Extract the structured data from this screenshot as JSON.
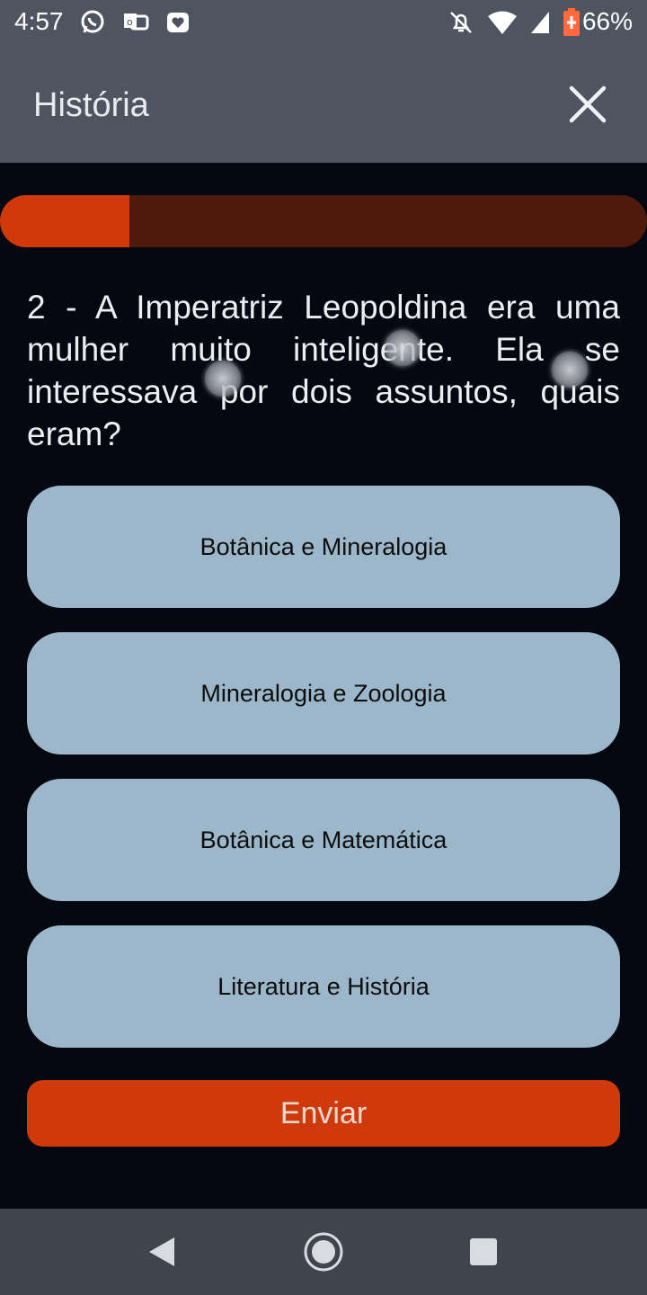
{
  "status_bar": {
    "time": "4:57",
    "battery": "66%",
    "left_icons": [
      "whatsapp-icon",
      "teams-icon",
      "heart-bag-icon"
    ],
    "right_icons": [
      "notifications-off-icon",
      "wifi-icon",
      "signal-icon",
      "battery-icon"
    ]
  },
  "app_bar": {
    "title": "História",
    "close_icon": "close-icon"
  },
  "progress": {
    "value": 0.2,
    "fill_color": "#cf390b",
    "track_color": "#4e1a0b"
  },
  "question": {
    "text": "2 - A Imperatriz Leopoldina era uma mulher muito inteligente. Ela se interessava por dois assuntos, quais eram?"
  },
  "options": [
    {
      "label": "Botânica e Mineralogia"
    },
    {
      "label": "Mineralogia e Zoologia"
    },
    {
      "label": "Botânica e Matemática"
    },
    {
      "label": "Literatura e História"
    }
  ],
  "submit": {
    "label": "Enviar"
  },
  "nav_bar": {
    "buttons": [
      "back-icon",
      "home-icon",
      "recents-icon"
    ]
  },
  "colors": {
    "background": "#050810",
    "app_bar": "#4f5461",
    "option_bg": "#9cb6ca",
    "accent": "#cf390b"
  }
}
